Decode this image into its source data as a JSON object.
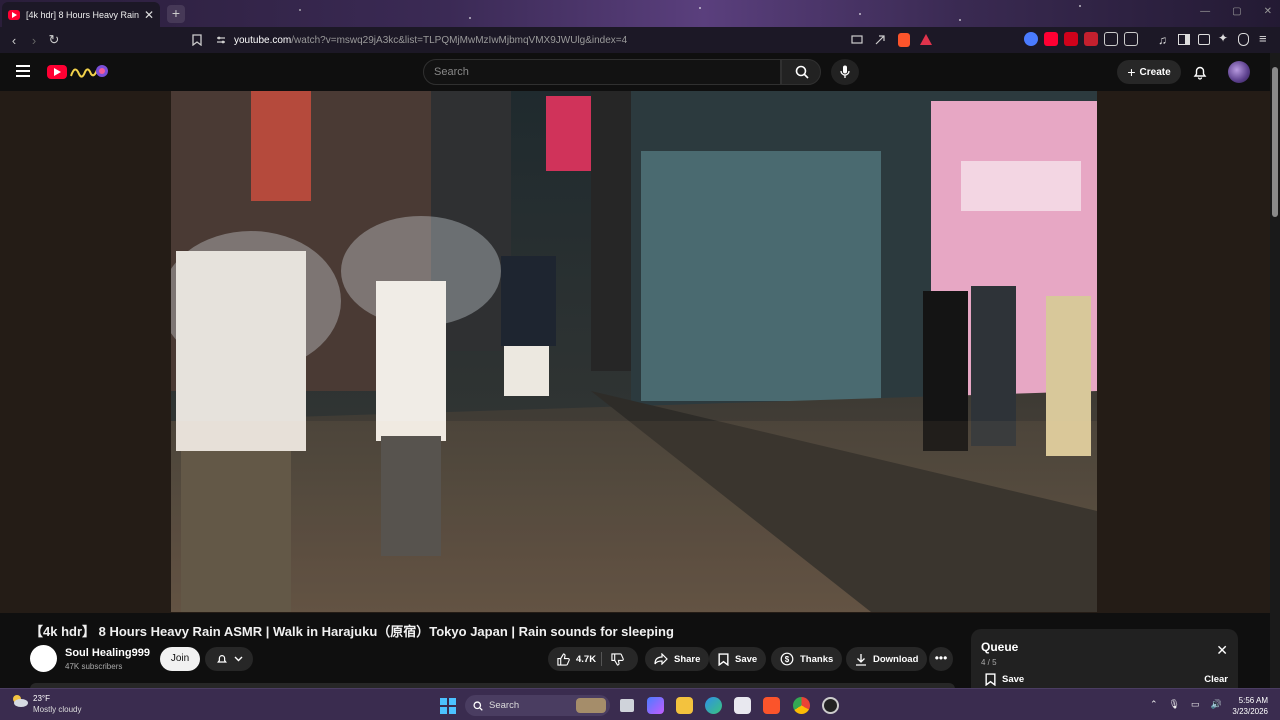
{
  "browser": {
    "tab_title": "[4k hdr] 8 Hours Heavy Rain",
    "tab_close": "✕",
    "new_tab": "+",
    "url_host": "youtube.com",
    "url_path": "/watch?v=mswq29jA3kc&list=TLPQMjMwMzIwMjbmqVMX9JWUlg&index=4"
  },
  "youtube": {
    "search_placeholder": "Search",
    "create_label": "Create"
  },
  "video": {
    "title": "【4k hdr】 8 Hours Heavy Rain ASMR | Walk in Harajuku（原宿）Tokyo Japan | Rain sounds for sleeping",
    "channel_name": "Soul Healing999",
    "channel_subs": "47K subscribers",
    "join_label": "Join",
    "like_count": "4.7K",
    "share_label": "Share",
    "save_label": "Save",
    "thanks_label": "Thanks",
    "download_label": "Download",
    "more_label": "•••"
  },
  "queue": {
    "title": "Queue",
    "count": "4 / 5",
    "save_label": "Save",
    "clear_label": "Clear"
  },
  "taskbar": {
    "temp": "23°F",
    "condition": "Mostly cloudy",
    "search_label": "Search",
    "time": "5:56 AM",
    "date": "3/23/2026"
  },
  "colors": {
    "youtube_red": "#ff0033",
    "background": "#0f0f0f",
    "taskbar": "#3a2c4f"
  }
}
